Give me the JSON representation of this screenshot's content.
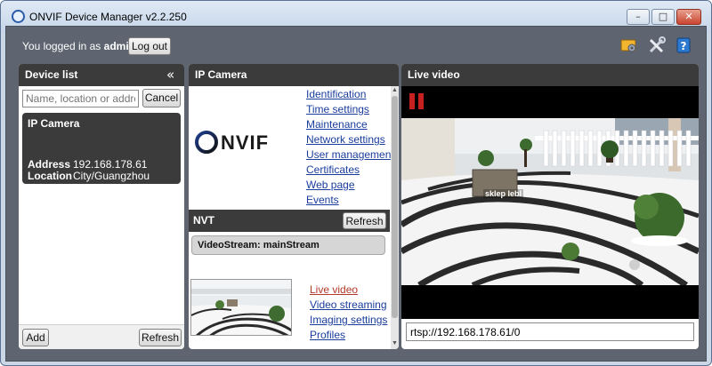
{
  "window": {
    "title": "ONVIF Device Manager v2.2.250",
    "minimize": "–",
    "maximize": "□",
    "close": "✕"
  },
  "header": {
    "logged_in_prefix": "You logged in as",
    "user": "admin",
    "logout_label": "Log out",
    "icons": [
      "settings-icon",
      "tools-icon",
      "help-icon"
    ]
  },
  "device_list": {
    "title": "Device list",
    "collapse_glyph": "«",
    "search_placeholder": "Name, location or address",
    "cancel_label": "Cancel",
    "devices": [
      {
        "name": "IP Camera",
        "address_label": "Address",
        "address": "192.168.178.61",
        "location_label": "Location",
        "location": "City/Guangzhou"
      }
    ],
    "add_label": "Add",
    "refresh_label": "Refresh"
  },
  "ip_camera": {
    "title": "IP Camera",
    "logo_text": "NVIF",
    "menu": [
      "Identification",
      "Time settings",
      "Maintenance",
      "Network settings",
      "User management",
      "Certificates",
      "Web page",
      "Events"
    ],
    "nvt_title": "NVT",
    "nvt_refresh_label": "Refresh",
    "stream_label": "VideoStream: mainStream",
    "stream_menu": [
      "Live video",
      "Video streaming",
      "Imaging settings",
      "Profiles"
    ],
    "active_stream_item": 0
  },
  "live_video": {
    "title": "Live video",
    "sign_text": "sklep lebl",
    "url": "rtsp://192.168.178.61/0"
  },
  "colors": {
    "frame": "#5e6470",
    "panel_header": "#3b3b3b",
    "link": "#1a3d9c",
    "active_link": "#b33a2a",
    "pause": "#c62020"
  }
}
